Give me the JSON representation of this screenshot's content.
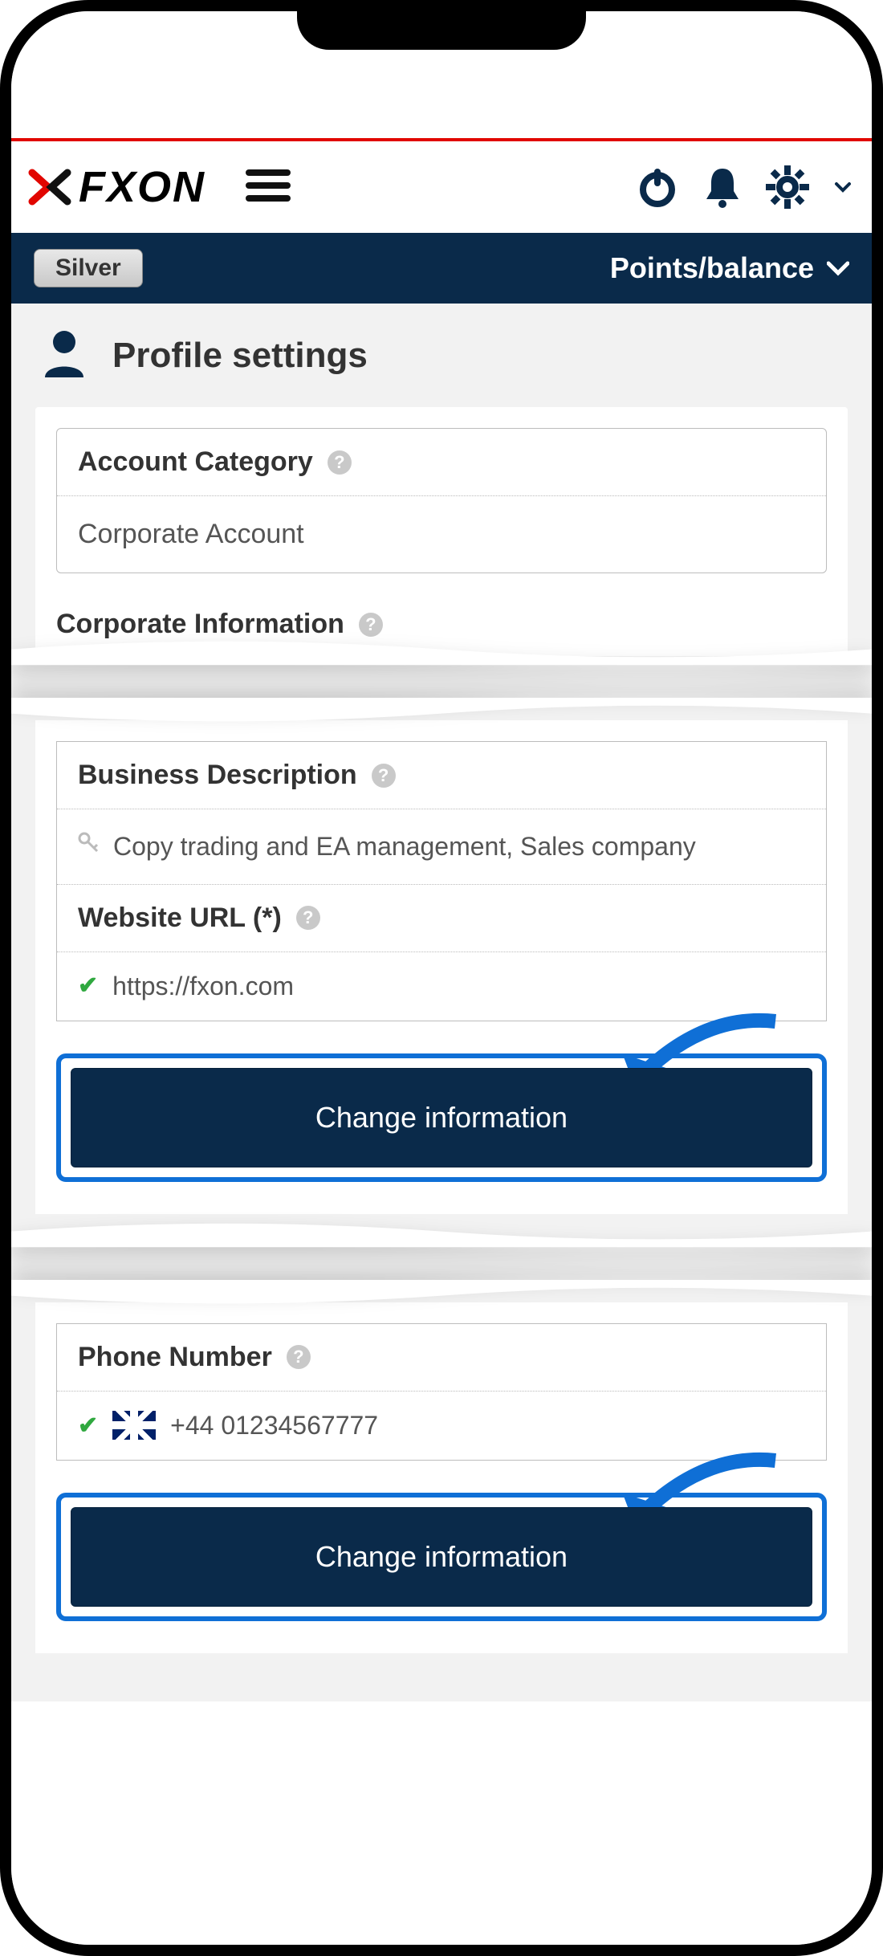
{
  "header": {
    "logo_text": "FXON",
    "badge": "Silver",
    "points_label": "Points/balance"
  },
  "page": {
    "title": "Profile settings"
  },
  "account_category": {
    "label": "Account Category",
    "value": "Corporate Account"
  },
  "corporate_info": {
    "title": "Corporate Information"
  },
  "business_description": {
    "label": "Business Description",
    "value": "Copy trading and EA management, Sales company"
  },
  "website": {
    "label": "Website URL (*)",
    "value": "https://fxon.com"
  },
  "buttons": {
    "change_info": "Change information"
  },
  "phone": {
    "label": "Phone Number",
    "value": "+44 01234567777"
  }
}
